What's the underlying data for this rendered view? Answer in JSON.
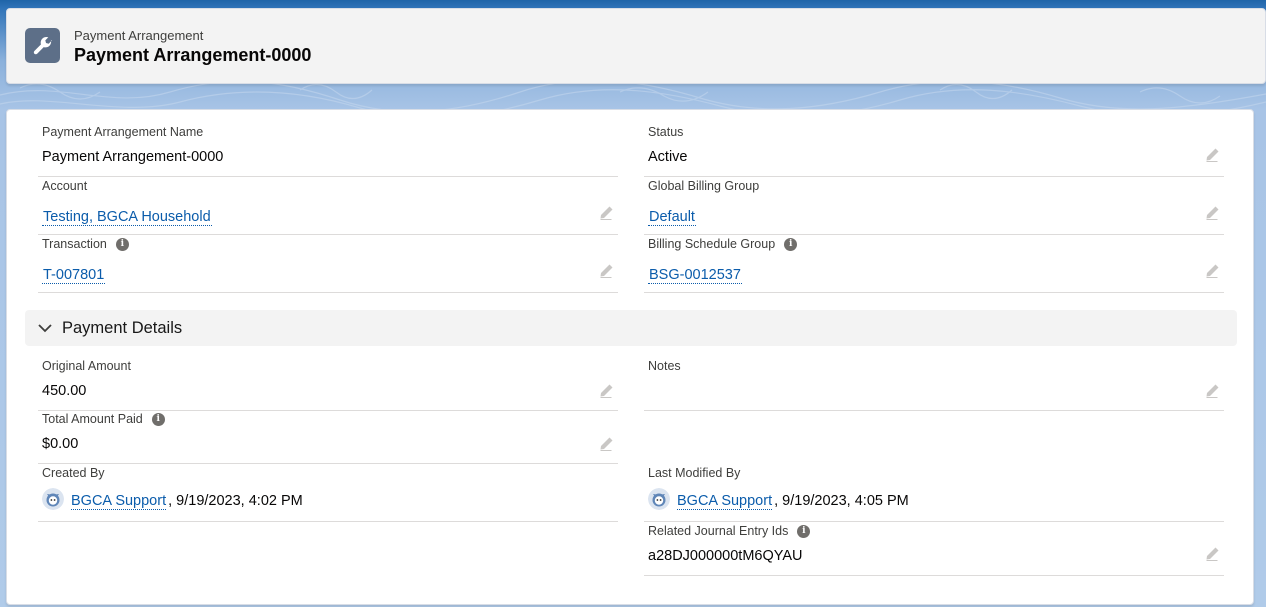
{
  "header": {
    "object_type": "Payment Arrangement",
    "record_name": "Payment Arrangement-0000",
    "icon": "wrench-icon"
  },
  "fields": {
    "name": {
      "label": "Payment Arrangement Name",
      "value": "Payment Arrangement-0000"
    },
    "status": {
      "label": "Status",
      "value": "Active"
    },
    "account": {
      "label": "Account",
      "value": "Testing, BGCA Household"
    },
    "global_billing_group": {
      "label": "Global Billing Group",
      "value": "Default"
    },
    "transaction": {
      "label": "Transaction",
      "value": "T-007801"
    },
    "billing_schedule_group": {
      "label": "Billing Schedule Group",
      "value": "BSG-0012537"
    }
  },
  "section": {
    "title": "Payment Details",
    "expanded": true,
    "fields": {
      "original_amount": {
        "label": "Original Amount",
        "value": "450.00"
      },
      "notes": {
        "label": "Notes",
        "value": ""
      },
      "total_amount_paid": {
        "label": "Total Amount Paid",
        "value": "$0.00"
      },
      "created_by": {
        "label": "Created By",
        "user": "BGCA Support",
        "date": ", 9/19/2023, 4:02 PM"
      },
      "last_modified_by": {
        "label": "Last Modified By",
        "user": "BGCA Support",
        "date": ", 9/19/2023, 4:05 PM"
      },
      "related_journal_entry_ids": {
        "label": "Related Journal Entry Ids",
        "value": "a28DJ000000tM6QYAU"
      }
    }
  },
  "colors": {
    "link": "#0b5cab",
    "header_icon_bg": "#5d6f88",
    "brand_blue": "#1f64a8"
  }
}
